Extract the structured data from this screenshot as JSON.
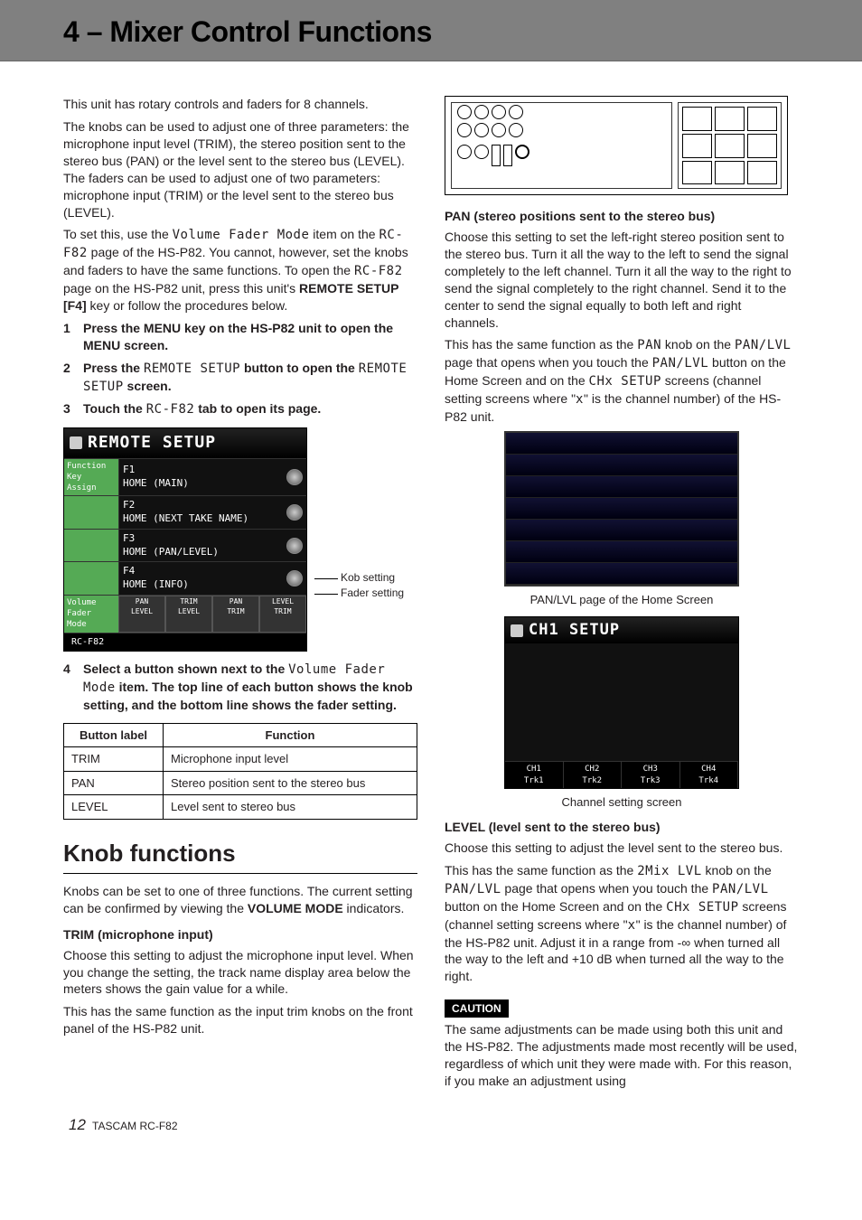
{
  "header": {
    "title": "4 – Mixer Control Functions"
  },
  "intro": {
    "p1": "This unit has rotary controls and faders for 8 channels.",
    "p2_a": "The knobs can be used to adjust one of three parameters: the microphone input level (TRIM), the stereo position sent to the stereo bus (PAN) or the level sent to the stereo bus (LEVEL). The faders can be used to adjust one of two parameters: microphone input (TRIM) or the level sent to the stereo bus (LEVEL).",
    "p3_a": "To set this, use the ",
    "p3_mono1": "Volume Fader Mode",
    "p3_b": " item on the ",
    "p3_mono2": "RC-F82",
    "p3_c": " page of the HS-P82. You cannot, however, set the knobs and faders to have the same functions. To open the ",
    "p3_mono3": "RC-F82",
    "p3_d": " page on the HS-P82 unit, press this unit's ",
    "p3_bold": "REMOTE SETUP [F4]",
    "p3_e": " key or follow the procedures below."
  },
  "steps": {
    "s1": "Press the MENU key on the HS-P82 unit to open the MENU screen.",
    "s2_a": "Press the ",
    "s2_mono1": "REMOTE SETUP",
    "s2_b": " button to open the ",
    "s2_mono2": "REMOTE SETUP",
    "s2_c": " screen.",
    "s3_a": "Touch the ",
    "s3_mono": "RC-F82",
    "s3_b": " tab to open its page.",
    "s4_a": "Select a button shown next to the ",
    "s4_mono": "Volume Fader Mode",
    "s4_b": " item. The top line of each button shows the knob setting, and the bottom line shows the fader setting."
  },
  "remote_setup": {
    "title": "REMOTE SETUP",
    "label_func": "Function Key Assign",
    "f1a": "F1",
    "f1b": "HOME (MAIN)",
    "f2a": "F2",
    "f2b": "HOME (NEXT TAKE NAME)",
    "f3a": "F3",
    "f3b": "HOME (PAN/LEVEL)",
    "f4a": "F4",
    "f4b": "HOME (INFO)",
    "label_vfm": "Volume Fader Mode",
    "m1a": "PAN",
    "m1b": "LEVEL",
    "m2a": "TRIM",
    "m2b": "LEVEL",
    "m3a": "PAN",
    "m3b": "TRIM",
    "m4a": "LEVEL",
    "m4b": "TRIM",
    "tab": "RC-F82",
    "callout_knob": "Kob setting",
    "callout_fader": "Fader setting"
  },
  "table": {
    "h1": "Button label",
    "h2": "Function",
    "rows": [
      {
        "label": "TRIM",
        "func": "Microphone input level"
      },
      {
        "label": "PAN",
        "func": "Stereo position sent to the stereo bus"
      },
      {
        "label": "LEVEL",
        "func": "Level sent to stereo bus"
      }
    ]
  },
  "knob_section": {
    "title": "Knob functions",
    "intro_a": "Knobs can be set to one of three functions. The current setting can be confirmed by viewing the ",
    "intro_bold": "VOLUME MODE",
    "intro_b": " indicators.",
    "trim_h": "TRIM (microphone input)",
    "trim_p1": "Choose this setting to adjust the microphone input level. When you change the setting, the track name display area below the meters shows the gain value for a while.",
    "trim_p2": "This has the same function as the input trim knobs on the front panel of the HS-P82 unit."
  },
  "pan_section": {
    "h": "PAN (stereo positions sent to the stereo bus)",
    "p1": "Choose this setting to set the left-right stereo position sent to the stereo bus. Turn it all the way to the left to send the signal completely to the left channel. Turn it all the way to the right to send the signal completely to the right channel. Send it to the center to send the signal equally to both left and right channels.",
    "p2_a": "This has the same function as the ",
    "p2_m1": "PAN",
    "p2_b": " knob on the ",
    "p2_m2": "PAN/LVL",
    "p2_c": " page that opens when you touch the ",
    "p2_m3": "PAN/LVL",
    "p2_d": " button on the Home Screen and on the ",
    "p2_m4": "CHx SETUP",
    "p2_e": " screens (channel setting screens where \"",
    "p2_m5": "x",
    "p2_f": "\" is the channel number) of the HS-P82 unit.",
    "caption1": "PAN/LVL page of the Home Screen",
    "ch_title": "CH1 SETUP",
    "ch_tabs": [
      "CH1",
      "CH2",
      "CH3",
      "CH4"
    ],
    "ch_sub": [
      "Trk1",
      "Trk2",
      "Trk3",
      "Trk4"
    ],
    "caption2": "Channel setting screen"
  },
  "level_section": {
    "h": "LEVEL (level sent to the stereo bus)",
    "p1": "Choose this setting to adjust the level sent to the stereo bus.",
    "p2_a": "This has the same function as the ",
    "p2_m1": "2Mix LVL",
    "p2_b": " knob on the ",
    "p2_m2": "PAN/LVL",
    "p2_c": " page that opens when you touch the ",
    "p2_m3": "PAN/LVL",
    "p2_d": " button on the Home Screen and on the ",
    "p2_m4": "CHx SETUP",
    "p2_e": " screens (channel setting screens where \"",
    "p2_m5": "x",
    "p2_f": "\" is the channel number) of the HS-P82 unit. Adjust it in a range from -∞ when turned all the way to the left and +10 dB when turned all the way to the right."
  },
  "caution": {
    "label": "CAUTION",
    "text": "The same adjustments can be made using both this unit and the HS-P82. The adjustments made most recently will be used, regardless of which unit they were made with. For this reason, if you make an adjustment using"
  },
  "footer": {
    "page": "12",
    "model": "TASCAM RC-F82"
  }
}
